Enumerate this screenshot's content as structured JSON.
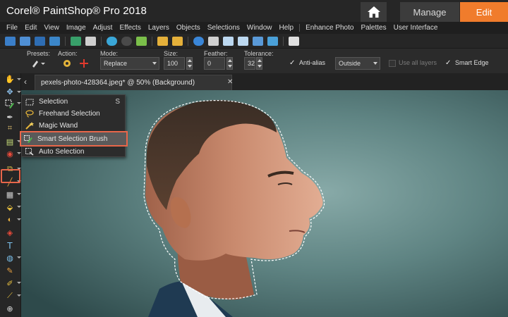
{
  "app": {
    "title": "Corel® PaintShop® Pro 2018",
    "workspace_tabs": [
      {
        "label": "Manage",
        "active": false
      },
      {
        "label": "Edit",
        "active": true
      }
    ],
    "accent_color": "#f07c2c"
  },
  "menubar": {
    "items": [
      "File",
      "Edit",
      "View",
      "Image",
      "Adjust",
      "Effects",
      "Layers",
      "Objects",
      "Selections",
      "Window",
      "Help",
      "Enhance Photo",
      "Palettes",
      "User Interface"
    ]
  },
  "toolbar": {
    "icons": [
      "new-icon",
      "browse-icon",
      "save-icon",
      "save-as-icon",
      "share-icon",
      "print-icon",
      "undo-icon",
      "redo-icon",
      "crop-to-selection-icon",
      "undo-history-icon",
      "redo-history-icon",
      "info-icon",
      "zoom-fit-icon",
      "fit-window-icon",
      "full-screen-icon",
      "learning-center-icon",
      "image-icon",
      "copy-icon"
    ]
  },
  "tool_options": {
    "presets_label": "Presets:",
    "action_label": "Action:",
    "mode_label": "Mode:",
    "mode_value": "Replace",
    "size_label": "Size:",
    "size_value": "100",
    "feather_label": "Feather:",
    "feather_value": "0",
    "tolerance_label": "Tolerance:",
    "tolerance_value": "32",
    "anti_alias_label": "Anti-alias",
    "anti_alias_checked": true,
    "anti_alias_mode": "Outside",
    "use_all_layers_label": "Use all layers",
    "use_all_layers_checked": false,
    "smart_edge_label": "Smart Edge",
    "smart_edge_checked": true
  },
  "tools_palette": {
    "tools": [
      "pan-tool",
      "move-tool",
      "smart-selection-brush-tool",
      "dropper-tool",
      "crop-tool",
      "straighten-tool",
      "red-eye-tool",
      "makeover-tool",
      "clone-brush-tool",
      "scratch-remover-tool",
      "eraser-tool",
      "paint-brush-tool",
      "lighten-darken-tool",
      "fill-tool",
      "color-changer-tool",
      "text-tool",
      "preset-shape-tool",
      "pen-tool",
      "warp-brush-tool",
      "art-media-tool",
      "oil-brush-tool",
      "zoom-tool"
    ]
  },
  "document": {
    "tab_label": "pexels-photo-428364.jpeg* @  50% (Background)"
  },
  "selection_flyout": {
    "items": [
      {
        "label": "Selection",
        "shortcut": "S",
        "icon": "rectangle-selection-icon",
        "active": false
      },
      {
        "label": "Freehand Selection",
        "shortcut": "",
        "icon": "lasso-icon",
        "active": false
      },
      {
        "label": "Magic Wand",
        "shortcut": "",
        "icon": "magic-wand-icon",
        "active": false
      },
      {
        "label": "Smart Selection Brush",
        "shortcut": "",
        "icon": "smart-selection-brush-icon",
        "active": true
      },
      {
        "label": "Auto Selection",
        "shortcut": "",
        "icon": "auto-selection-icon",
        "active": false
      }
    ]
  }
}
